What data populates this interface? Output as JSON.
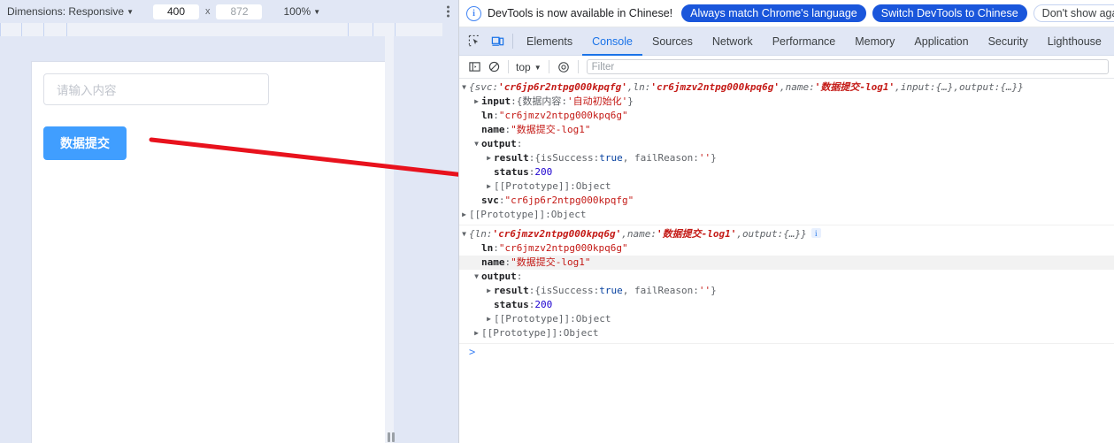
{
  "device_toolbar": {
    "dimensions_label": "Dimensions: Responsive",
    "width_value": "400",
    "height_value": "872",
    "separator": "x",
    "zoom_value": "100%",
    "more_options_icon": "kebab-menu-icon"
  },
  "viewport": {
    "input_placeholder": "请输入内容",
    "submit_button_label": "数据提交",
    "button_color": "#409eff"
  },
  "annotation": {
    "arrow_color": "#e8121d"
  },
  "devtools": {
    "infobar": {
      "icon": "info-icon",
      "message": "DevTools is now available in Chinese!",
      "primary_button": "Always match Chrome's language",
      "secondary_button": "Switch DevTools to Chinese",
      "dismiss_button": "Don't show again"
    },
    "toolbar_icons": [
      {
        "name": "inspect-element-icon"
      },
      {
        "name": "device-toolbar-toggle-icon"
      }
    ],
    "tabs": [
      {
        "label": "Elements",
        "active": false
      },
      {
        "label": "Console",
        "active": true
      },
      {
        "label": "Sources",
        "active": false
      },
      {
        "label": "Network",
        "active": false
      },
      {
        "label": "Performance",
        "active": false
      },
      {
        "label": "Memory",
        "active": false
      },
      {
        "label": "Application",
        "active": false
      },
      {
        "label": "Security",
        "active": false
      },
      {
        "label": "Lighthouse",
        "active": false
      }
    ],
    "console_toolbar": {
      "sidebar_icon": "console-sidebar-icon",
      "clear_icon": "clear-console-icon",
      "context_value": "top",
      "eye_icon": "live-expression-icon",
      "filter_placeholder": "Filter"
    },
    "console": {
      "prompt_symbol": ">",
      "entries": [
        {
          "header": {
            "open_brace": "{",
            "parts": [
              {
                "key": "svc",
                "value": "'cr6jp6r2ntpg000kpqfg'"
              },
              {
                "key": "ln",
                "value": "'cr6jmzv2ntpg000kpq6g'"
              },
              {
                "key": "name",
                "value": "'数据提交-log1'"
              },
              {
                "key": "input",
                "value": "{…}"
              },
              {
                "key": "output",
                "value": "{…}"
              }
            ],
            "close_brace": "}"
          },
          "rows": [
            {
              "twisty": "closed",
              "indent": 1,
              "key": "input",
              "sep": ": ",
              "value": "{数据内容: '自动初始化'}",
              "value_kind": "objectstr",
              "inner_str": "'自动初始化'",
              "inner_pre": "{数据内容: ",
              "inner_post": "}"
            },
            {
              "twisty": "empty",
              "indent": 1,
              "key": "ln",
              "sep": ": ",
              "value": "\"cr6jmzv2ntpg000kpq6g\"",
              "value_kind": "string"
            },
            {
              "twisty": "empty",
              "indent": 1,
              "key": "name",
              "sep": ": ",
              "value": "\"数据提交-log1\"",
              "value_kind": "string"
            },
            {
              "twisty": "open",
              "indent": 1,
              "key": "output",
              "sep": ":",
              "value": "",
              "value_kind": "none"
            },
            {
              "twisty": "closed",
              "indent": 2,
              "key": "result",
              "sep": ": ",
              "value": "{isSuccess: true, failReason: ''}",
              "value_kind": "result"
            },
            {
              "twisty": "empty",
              "indent": 2,
              "key": "status",
              "sep": ": ",
              "value": "200",
              "value_kind": "number"
            },
            {
              "twisty": "closed",
              "indent": 2,
              "key": "[[Prototype]]",
              "sep": ": ",
              "value": "Object",
              "value_kind": "proto"
            },
            {
              "twisty": "empty",
              "indent": 1,
              "key": "svc",
              "sep": ": ",
              "value": "\"cr6jp6r2ntpg000kpqfg\"",
              "value_kind": "string"
            },
            {
              "twisty": "closed",
              "indent": 0,
              "key": "[[Prototype]]",
              "sep": ": ",
              "value": "Object",
              "value_kind": "proto"
            }
          ]
        },
        {
          "header": {
            "open_brace": "{",
            "parts": [
              {
                "key": "ln",
                "value": "'cr6jmzv2ntpg000kpq6g'"
              },
              {
                "key": "name",
                "value": "'数据提交-log1'"
              },
              {
                "key": "output",
                "value": "{…}"
              }
            ],
            "close_brace": "}",
            "info_badge": "i"
          },
          "rows": [
            {
              "twisty": "empty",
              "indent": 1,
              "key": "ln",
              "sep": ": ",
              "value": "\"cr6jmzv2ntpg000kpq6g\"",
              "value_kind": "string"
            },
            {
              "twisty": "empty",
              "indent": 1,
              "key": "name",
              "sep": ": ",
              "value": "\"数据提交-log1\"",
              "value_kind": "string",
              "highlight": true
            },
            {
              "twisty": "open",
              "indent": 1,
              "key": "output",
              "sep": ":",
              "value": "",
              "value_kind": "none"
            },
            {
              "twisty": "closed",
              "indent": 2,
              "key": "result",
              "sep": ": ",
              "value": "{isSuccess: true, failReason: ''}",
              "value_kind": "result"
            },
            {
              "twisty": "empty",
              "indent": 2,
              "key": "status",
              "sep": ": ",
              "value": "200",
              "value_kind": "number"
            },
            {
              "twisty": "closed",
              "indent": 2,
              "key": "[[Prototype]]",
              "sep": ": ",
              "value": "Object",
              "value_kind": "proto"
            },
            {
              "twisty": "closed",
              "indent": 1,
              "key": "[[Prototype]]",
              "sep": ": ",
              "value": "Object",
              "value_kind": "proto"
            }
          ]
        }
      ]
    }
  }
}
